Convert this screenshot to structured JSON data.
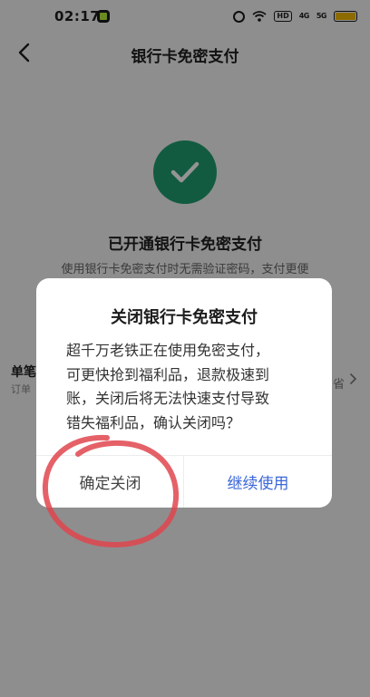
{
  "status_bar": {
    "time": "02:17",
    "icons": [
      "notification-app-icon",
      "alarm-icon",
      "wifi-icon",
      "hd-icon",
      "signal-icon",
      "signal-icon",
      "battery-icon"
    ],
    "hd_label": "HD",
    "signal_1_label": "4G",
    "signal_2_label": "5G",
    "battery_color": "#f2b800"
  },
  "nav": {
    "back_icon": "chevron-left-icon",
    "title": "银行卡免密支付"
  },
  "status": {
    "icon": "check-circle-icon",
    "icon_color": "#1f9e6f",
    "title": "已开通银行卡免密支付",
    "description": "使用银行卡免密支付时无需验证密码，支付更便"
  },
  "limit_row": {
    "title": "单笔",
    "subtitle": "订单",
    "value": "省"
  },
  "dialog": {
    "title": "关闭银行卡免密支付",
    "body_lines": [
      "超千万老铁正在使用免密支付，",
      "可更快抢到福利品，退款极速到",
      "账，关闭后将无法快速支付导致",
      "错失福利品，确认关闭吗？"
    ],
    "confirm_label": "确定关闭",
    "continue_label": "继续使用",
    "continue_color": "#3a66d8"
  },
  "annotation": {
    "color": "#e0454d"
  }
}
